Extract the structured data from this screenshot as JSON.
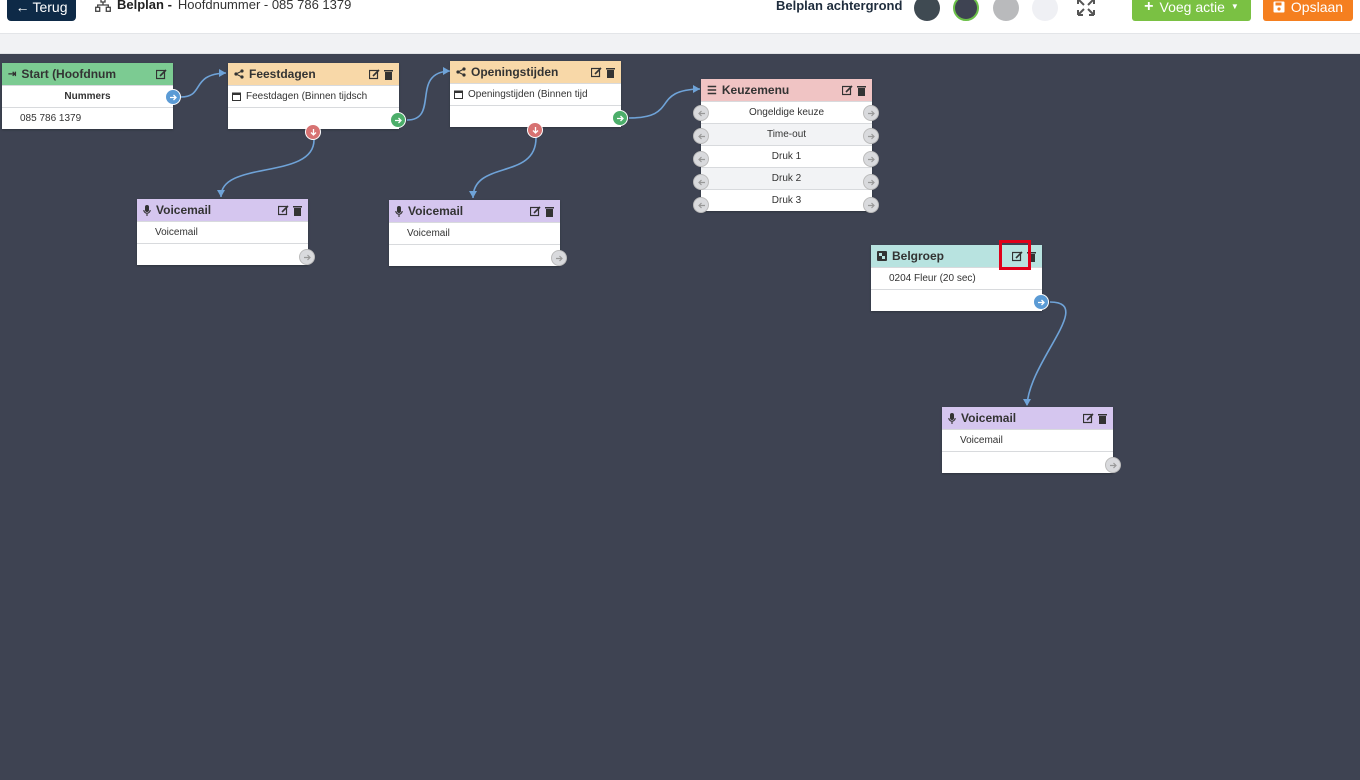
{
  "header": {
    "back_label": "Terug",
    "title_bold": "Belplan -",
    "title_rest": "Hoofdnummer - 085 786 1379",
    "background_label": "Belplan achtergrond",
    "add_action_label": "Voeg actie",
    "save_label": "Opslaan",
    "swatches": [
      "#3f4a52",
      "#3e4352",
      "#b9babc",
      "#eff0f4"
    ],
    "active_swatch": 1
  },
  "nodes": {
    "start": {
      "title": "Start (Hoofdnum",
      "section": "Nummers",
      "number": "085 786 1379"
    },
    "feestdagen": {
      "title": "Feestdagen",
      "row": "Feestdagen (Binnen tijdsch"
    },
    "openingstijden": {
      "title": "Openingstijden",
      "row": "Openingstijden (Binnen tijd"
    },
    "keuzemenu": {
      "title": "Keuzemenu",
      "options": [
        "Ongeldige keuze",
        "Time-out",
        "Druk 1",
        "Druk 2",
        "Druk 3"
      ]
    },
    "belgroep": {
      "title": "Belgroep",
      "row": "0204 Fleur (20 sec)"
    },
    "voicemail1": {
      "title": "Voicemail",
      "row": "Voicemail"
    },
    "voicemail2": {
      "title": "Voicemail",
      "row": "Voicemail"
    },
    "voicemail3": {
      "title": "Voicemail",
      "row": "Voicemail"
    }
  },
  "colors": {
    "canvas": "#3e4352",
    "wire": "#6fa3d8",
    "start_header": "#7ccb92",
    "time_header": "#f8d8a8",
    "menu_header": "#f0c4c4",
    "voicemail_header": "#d5c6ef",
    "group_header": "#b8e3e0",
    "highlight": "#e0001a"
  }
}
